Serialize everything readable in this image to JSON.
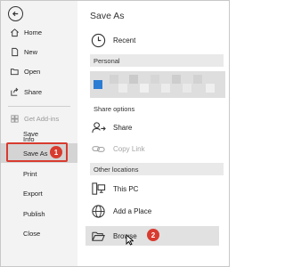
{
  "sidebar": {
    "items": [
      {
        "label": "Home",
        "icon": "home-icon"
      },
      {
        "label": "New",
        "icon": "new-document-icon"
      },
      {
        "label": "Open",
        "icon": "open-folder-icon"
      },
      {
        "label": "Share",
        "icon": "share-icon"
      },
      {
        "label": "Get Add-ins",
        "icon": "add-ins-icon"
      },
      {
        "label": "Info"
      },
      {
        "label": "Save"
      },
      {
        "label": "Save As"
      },
      {
        "label": "Print"
      },
      {
        "label": "Export"
      },
      {
        "label": "Publish"
      },
      {
        "label": "Close"
      }
    ]
  },
  "main": {
    "title": "Save As",
    "recent": "Recent",
    "personal_header": "Personal",
    "share_options_header": "Share options",
    "share": "Share",
    "copy_link": "Copy Link",
    "other_locations_header": "Other locations",
    "this_pc": "This PC",
    "add_place": "Add a Place",
    "browse": "Browse"
  },
  "annotations": {
    "step1": "1",
    "step2": "2"
  },
  "colors": {
    "annotation_red": "#d83b2f",
    "cloud_blue": "#2b7cd3",
    "sidebar_bg": "#f3f3f3"
  }
}
